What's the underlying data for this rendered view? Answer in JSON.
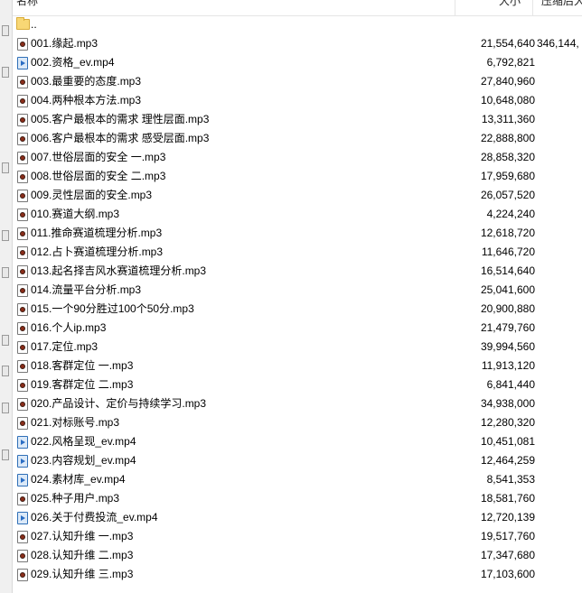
{
  "columns": {
    "name": "名称",
    "size": "大小",
    "packed": "压缩后大"
  },
  "parent_dir": "..",
  "files": [
    {
      "name": "001.缘起.mp3",
      "type": "mp3",
      "size": "21,554,640",
      "packed": "346,144,"
    },
    {
      "name": "002.资格_ev.mp4",
      "type": "mp4",
      "size": "6,792,821",
      "packed": ""
    },
    {
      "name": "003.最重要的态度.mp3",
      "type": "mp3",
      "size": "27,840,960",
      "packed": ""
    },
    {
      "name": "004.两种根本方法.mp3",
      "type": "mp3",
      "size": "10,648,080",
      "packed": ""
    },
    {
      "name": "005.客户最根本的需求 理性层面.mp3",
      "type": "mp3",
      "size": "13,311,360",
      "packed": ""
    },
    {
      "name": "006.客户最根本的需求 感受层面.mp3",
      "type": "mp3",
      "size": "22,888,800",
      "packed": ""
    },
    {
      "name": "007.世俗层面的安全 一.mp3",
      "type": "mp3",
      "size": "28,858,320",
      "packed": ""
    },
    {
      "name": "008.世俗层面的安全 二.mp3",
      "type": "mp3",
      "size": "17,959,680",
      "packed": ""
    },
    {
      "name": "009.灵性层面的安全.mp3",
      "type": "mp3",
      "size": "26,057,520",
      "packed": ""
    },
    {
      "name": "010.赛道大纲.mp3",
      "type": "mp3",
      "size": "4,224,240",
      "packed": ""
    },
    {
      "name": "011.推命赛道梳理分析.mp3",
      "type": "mp3",
      "size": "12,618,720",
      "packed": ""
    },
    {
      "name": "012.占卜赛道梳理分析.mp3",
      "type": "mp3",
      "size": "11,646,720",
      "packed": ""
    },
    {
      "name": "013.起名择吉风水赛道梳理分析.mp3",
      "type": "mp3",
      "size": "16,514,640",
      "packed": ""
    },
    {
      "name": "014.流量平台分析.mp3",
      "type": "mp3",
      "size": "25,041,600",
      "packed": ""
    },
    {
      "name": "015.一个90分胜过100个50分.mp3",
      "type": "mp3",
      "size": "20,900,880",
      "packed": ""
    },
    {
      "name": "016.个人ip.mp3",
      "type": "mp3",
      "size": "21,479,760",
      "packed": ""
    },
    {
      "name": "017.定位.mp3",
      "type": "mp3",
      "size": "39,994,560",
      "packed": ""
    },
    {
      "name": "018.客群定位 一.mp3",
      "type": "mp3",
      "size": "11,913,120",
      "packed": ""
    },
    {
      "name": "019.客群定位 二.mp3",
      "type": "mp3",
      "size": "6,841,440",
      "packed": ""
    },
    {
      "name": "020.产品设计、定价与持续学习.mp3",
      "type": "mp3",
      "size": "34,938,000",
      "packed": ""
    },
    {
      "name": "021.对标账号.mp3",
      "type": "mp3",
      "size": "12,280,320",
      "packed": ""
    },
    {
      "name": "022.风格呈现_ev.mp4",
      "type": "mp4",
      "size": "10,451,081",
      "packed": ""
    },
    {
      "name": "023.内容规划_ev.mp4",
      "type": "mp4",
      "size": "12,464,259",
      "packed": ""
    },
    {
      "name": "024.素材库_ev.mp4",
      "type": "mp4",
      "size": "8,541,353",
      "packed": ""
    },
    {
      "name": "025.种子用户.mp3",
      "type": "mp3",
      "size": "18,581,760",
      "packed": ""
    },
    {
      "name": "026.关于付费投流_ev.mp4",
      "type": "mp4",
      "size": "12,720,139",
      "packed": ""
    },
    {
      "name": "027.认知升维 一.mp3",
      "type": "mp3",
      "size": "19,517,760",
      "packed": ""
    },
    {
      "name": "028.认知升维 二.mp3",
      "type": "mp3",
      "size": "17,347,680",
      "packed": ""
    },
    {
      "name": "029.认知升维 三.mp3",
      "type": "mp3",
      "size": "17,103,600",
      "packed": ""
    }
  ]
}
